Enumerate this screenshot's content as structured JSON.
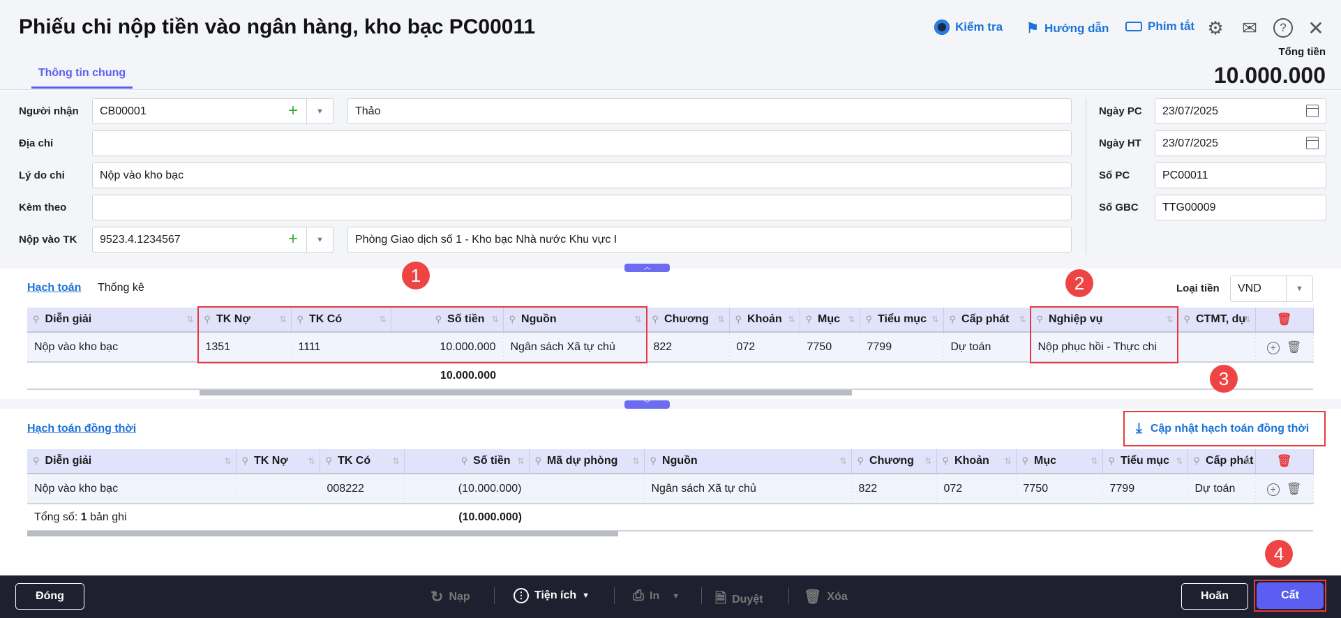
{
  "header": {
    "title": "Phiếu chi nộp tiền vào ngân hàng, kho bạc PC00011",
    "tab": "Thông tin chung",
    "links": [
      {
        "label": "Kiểm tra",
        "icon": "robot-icon"
      },
      {
        "label": "Hướng dẫn",
        "icon": "signpost-icon"
      },
      {
        "label": "Phím tắt",
        "icon": "keyboard-icon"
      }
    ],
    "total_label": "Tổng tiền",
    "total_value": "10.000.000"
  },
  "form": {
    "nguoi_nhan": {
      "label": "Người nhận",
      "code": "CB00001",
      "name": "Thảo"
    },
    "dia_chi": {
      "label": "Địa chỉ",
      "value": ""
    },
    "ly_do": {
      "label": "Lý do chi",
      "value": "Nộp vào kho bạc"
    },
    "kem_theo": {
      "label": "Kèm theo",
      "value": ""
    },
    "nop_vao_tk": {
      "label": "Nộp vào TK",
      "code": "9523.4.1234567",
      "name": "Phòng Giao dịch số 1 - Kho bạc Nhà nước Khu vực I"
    },
    "ngay_pc": {
      "label": "Ngày PC",
      "value": "23/07/2025"
    },
    "ngay_ht": {
      "label": "Ngày HT",
      "value": "23/07/2025"
    },
    "so_pc": {
      "label": "Số PC",
      "value": "PC00011"
    },
    "so_gbc": {
      "label": "Số GBC",
      "value": "TTG00009"
    }
  },
  "section1": {
    "tabs": [
      "Hạch toán",
      "Thống kê"
    ],
    "currency_label": "Loại tiền",
    "currency": "VND",
    "columns": [
      {
        "t": "Diễn giải"
      },
      {
        "t": "TK Nợ"
      },
      {
        "t": "TK Có"
      },
      {
        "t": "Số tiền",
        "r": true
      },
      {
        "t": "Nguồn"
      },
      {
        "t": "Chương"
      },
      {
        "t": "Khoản"
      },
      {
        "t": "Mục"
      },
      {
        "t": "Tiểu mục"
      },
      {
        "t": "Cấp phát"
      },
      {
        "t": "Nghiệp vụ"
      },
      {
        "t": "CTMT, dự"
      }
    ],
    "rows": [
      [
        "Nộp vào kho bạc",
        "1351",
        "1111",
        "10.000.000",
        "Ngân sách Xã tự chủ",
        "822",
        "072",
        "7750",
        "7799",
        "Dự toán",
        "Nộp phục hồi - Thực chi",
        ""
      ]
    ],
    "total": "10.000.000"
  },
  "section2": {
    "title": "Hạch toán đồng thời",
    "update_button": "Cập nhật hạch toán đồng thời",
    "columns": [
      {
        "t": "Diễn giải"
      },
      {
        "t": "TK Nợ"
      },
      {
        "t": "TK Có"
      },
      {
        "t": "Số tiền",
        "r": true
      },
      {
        "t": "Mã dự phòng"
      },
      {
        "t": "Nguồn"
      },
      {
        "t": "Chương"
      },
      {
        "t": "Khoản"
      },
      {
        "t": "Mục"
      },
      {
        "t": "Tiểu mục"
      },
      {
        "t": "Cấp phát"
      }
    ],
    "rows": [
      [
        "Nộp vào kho bạc",
        "",
        "008222",
        "(10.000.000)",
        "",
        "Ngân sách Xã tự chủ",
        "822",
        "072",
        "7750",
        "7799",
        "Dự toán"
      ]
    ],
    "total_prefix": "Tổng số:",
    "total_count": "1",
    "total_suffix": "bản ghi",
    "total": "(10.000.000)"
  },
  "badges": [
    "1",
    "2",
    "3",
    "4"
  ],
  "footer": {
    "close": "Đóng",
    "reload": "Nạp",
    "utilities": "Tiện ích",
    "print": "In",
    "approve": "Duyệt",
    "delete": "Xóa",
    "postpone": "Hoãn",
    "save": "Cất"
  },
  "colors": {
    "accent": "#5b5ef0",
    "link": "#1a73d9",
    "highlight": "#e8383b",
    "footer": "#1e2030"
  }
}
